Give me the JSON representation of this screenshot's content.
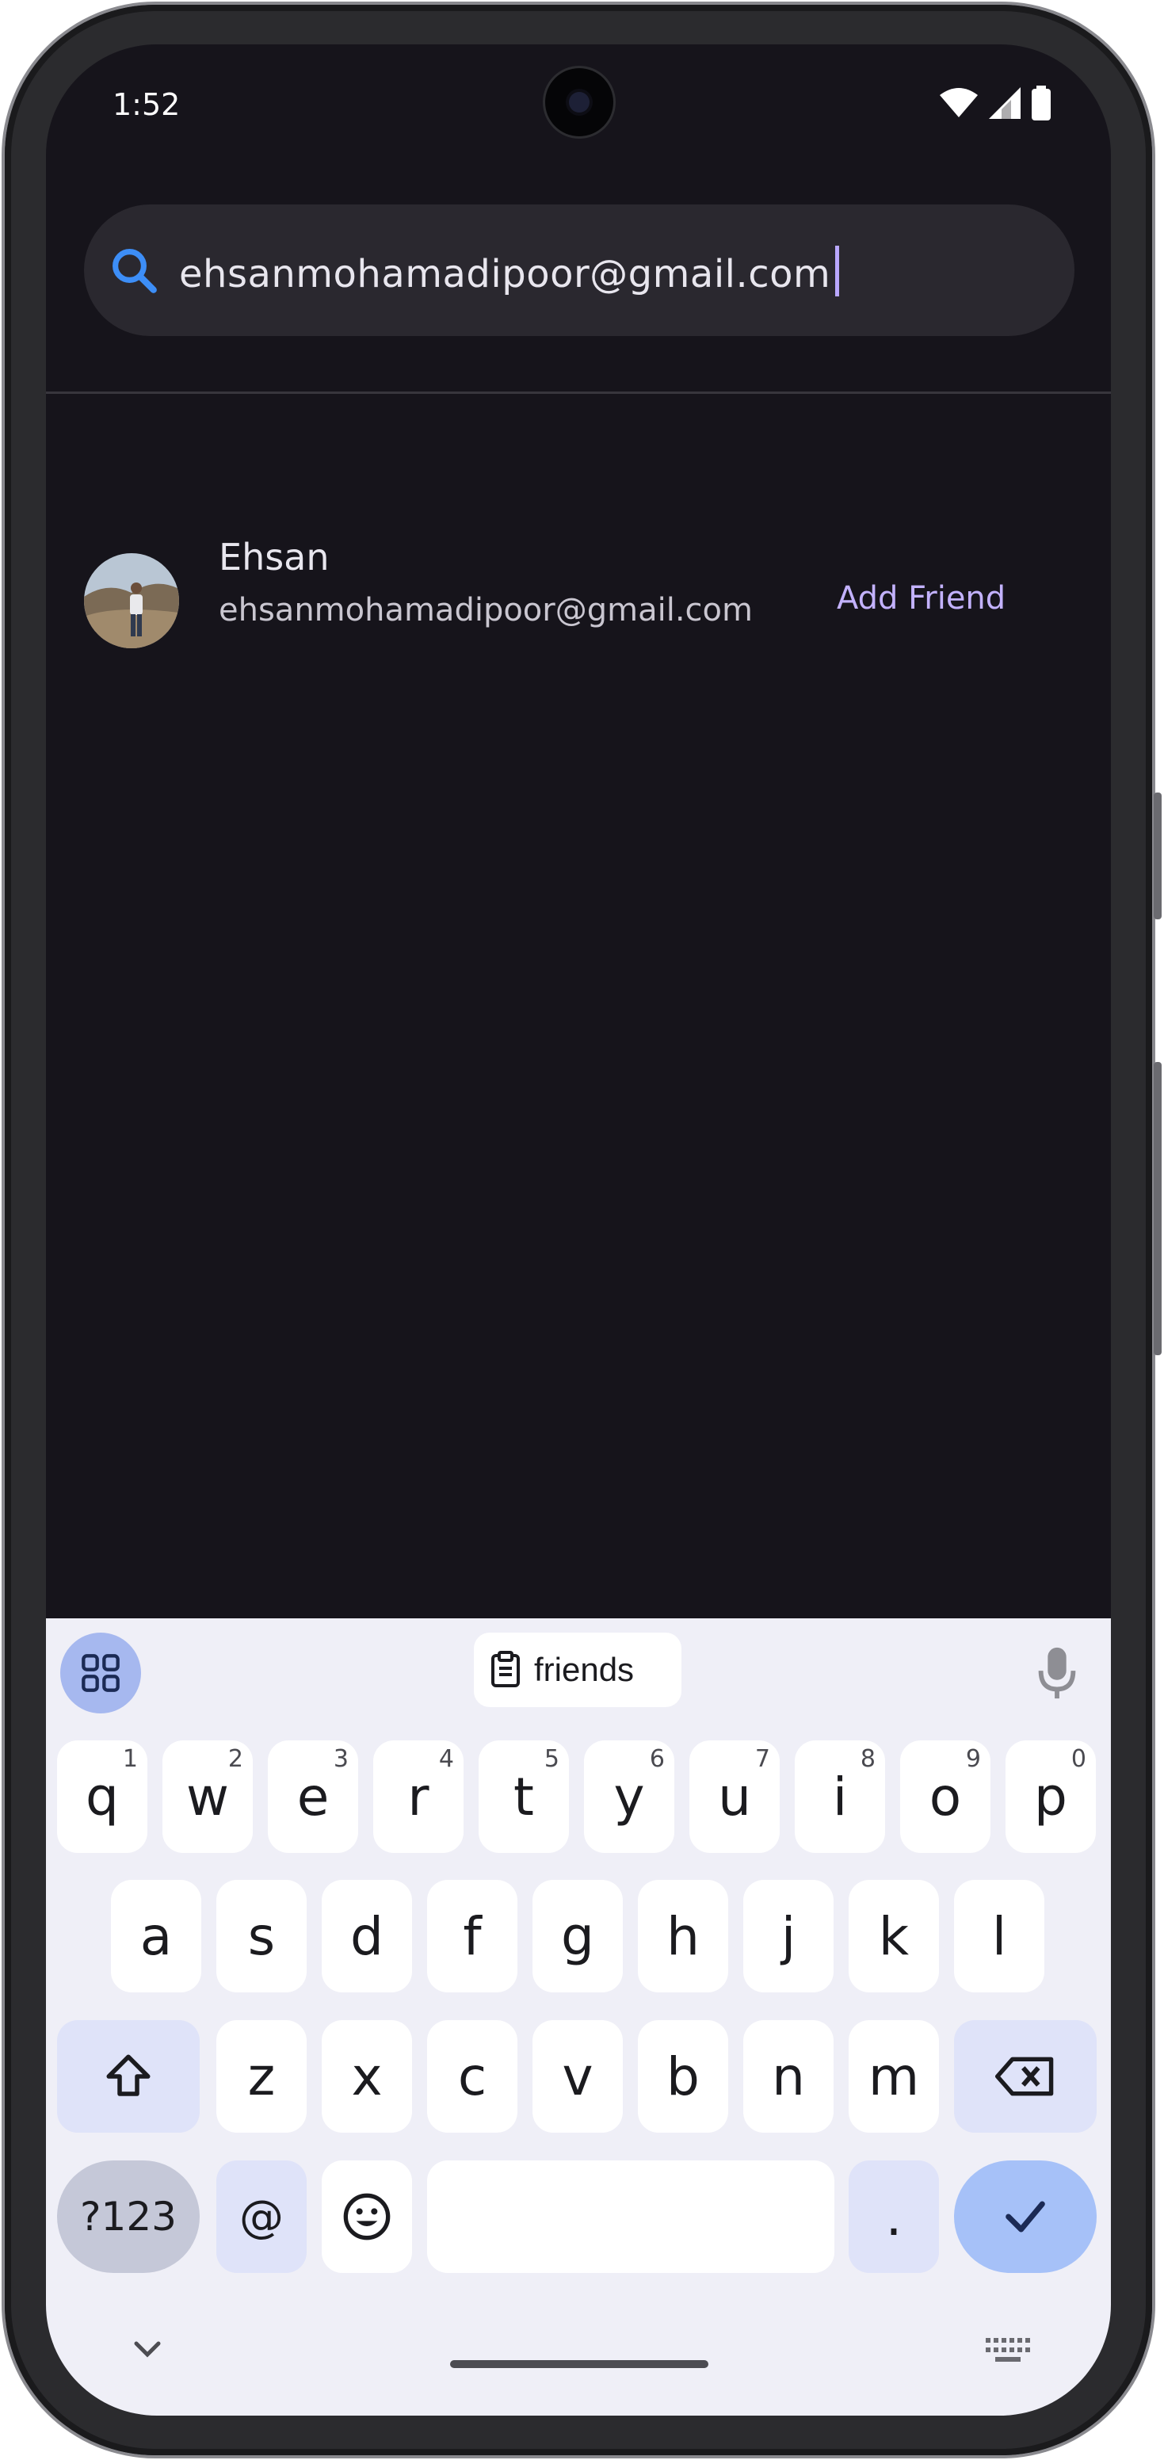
{
  "status_bar": {
    "time": "1:52",
    "icons": [
      "wifi-icon",
      "signal-icon",
      "battery-icon"
    ]
  },
  "search": {
    "query": "ehsanmohamadipoor@gmail.com",
    "icon": "search-icon"
  },
  "results": [
    {
      "name": "Ehsan",
      "email": "ehsanmohamadipoor@gmail.com",
      "action_label": "Add Friend"
    }
  ],
  "keyboard": {
    "clipboard_suggestion": "friends",
    "row1": [
      {
        "key": "q",
        "hint": "1"
      },
      {
        "key": "w",
        "hint": "2"
      },
      {
        "key": "e",
        "hint": "3"
      },
      {
        "key": "r",
        "hint": "4"
      },
      {
        "key": "t",
        "hint": "5"
      },
      {
        "key": "y",
        "hint": "6"
      },
      {
        "key": "u",
        "hint": "7"
      },
      {
        "key": "i",
        "hint": "8"
      },
      {
        "key": "o",
        "hint": "9"
      },
      {
        "key": "p",
        "hint": "0"
      }
    ],
    "row2": [
      "a",
      "s",
      "d",
      "f",
      "g",
      "h",
      "j",
      "k",
      "l"
    ],
    "row3": [
      "z",
      "x",
      "c",
      "v",
      "b",
      "n",
      "m"
    ],
    "symbols_label": "?123",
    "at_label": "@",
    "period_label": "."
  },
  "colors": {
    "background": "#16141b",
    "accent": "#c3b2ff",
    "search_icon": "#3d8ef7",
    "keyboard_bg": "#efeff7"
  }
}
